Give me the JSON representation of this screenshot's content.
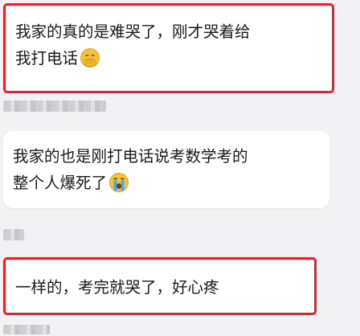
{
  "messages": [
    {
      "lines": [
        "我家的真的是难哭了，刚才哭着给",
        "我打电话"
      ],
      "emoji": "face-with-hand-over-mouth-icon",
      "highlighted": true
    },
    {
      "lines": [
        "我家的也是刚打电话说考数学考的",
        "整个人爆死了"
      ],
      "emoji": "loudly-crying-face-icon",
      "highlighted": false
    },
    {
      "lines": [
        "一样的，考完就哭了，好心疼"
      ],
      "highlighted": true
    }
  ],
  "colors": {
    "background": "#f2f2f4",
    "bubble": "#ffffff",
    "highlight_border": "#e8202a",
    "text": "#1a1a1a"
  }
}
